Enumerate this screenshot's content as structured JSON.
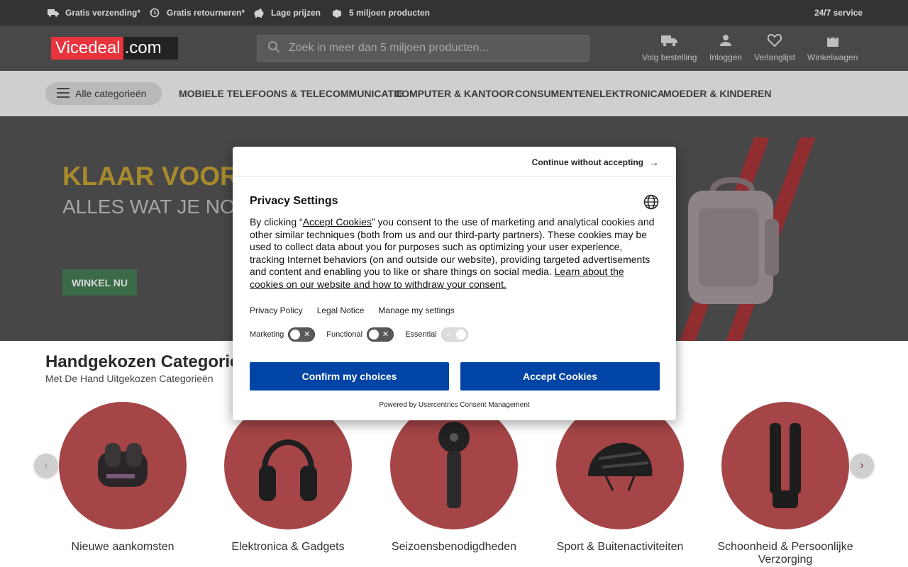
{
  "topbar": {
    "usps": [
      {
        "label": "Gratis verzending*",
        "icon": "truck-icon"
      },
      {
        "label": "Gratis retourneren*",
        "icon": "return-icon"
      },
      {
        "label": "Lage prijzen",
        "icon": "piggybank-icon"
      },
      {
        "label": "5 miljoen producten",
        "icon": "box-icon"
      }
    ],
    "service": "24/7 service"
  },
  "header": {
    "logo_brand": "Vicedeal",
    "logo_tld": ".com",
    "search_placeholder": "Zoek in meer dan 5 miljoen producten...",
    "nav": [
      {
        "label": "Volg bestelling",
        "icon": "truck-icon"
      },
      {
        "label": "Inloggen",
        "icon": "user-icon"
      },
      {
        "label": "Verlanglijst",
        "icon": "heart-icon"
      },
      {
        "label": "Winkelwagen",
        "icon": "bag-icon"
      }
    ]
  },
  "catbar": {
    "all_label": "Alle categorieën",
    "links": [
      "MOBIELE TELEFOONS & TELECOMMUNICATIE",
      "COMPUTER & KANTOOR",
      "CONSUMENTENELEKTRONICA",
      "MOEDER & KINDEREN"
    ]
  },
  "hero": {
    "title": "KLAAR VOOR V",
    "subtitle": "ALLES WAT JE NOD ONDERWEG",
    "button": "WINKEL NU"
  },
  "categories": {
    "title": "Handgekozen Categorieë",
    "subtitle": "Met De Hand Uitgekozen Categorieën",
    "items": [
      "Nieuwe aankomsten",
      "Elektronica & Gadgets",
      "Seizoensbenodigdheden",
      "Sport & Buitenactiviteiten",
      "Schoonheid & Persoonlijke Verzorging"
    ]
  },
  "consent": {
    "continue_label": "Continue without accepting",
    "title": "Privacy Settings",
    "body_pre": "By clicking “",
    "body_link1": "Accept Cookies",
    "body_mid": "” you consent to the use of marketing and analytical cookies and other similar techniques (both from us and our third-party partners). These cookies may be used to collect data about you for purposes such as optimizing your user experience, tracking Internet behaviors (on and outside our website), providing targeted advertisements and content and enabling you to like or share things on social media. ",
    "body_link2": "Learn about the cookies on our website and how to withdraw your consent.",
    "links": [
      "Privacy Policy",
      "Legal Notice",
      "Manage my settings"
    ],
    "toggles": [
      {
        "label": "Marketing",
        "on": false
      },
      {
        "label": "Functional",
        "on": false
      },
      {
        "label": "Essential",
        "on": true
      }
    ],
    "confirm_label": "Confirm my choices",
    "accept_label": "Accept Cookies",
    "powered": "Powered by Usercentrics Consent Management",
    "button_color": "#0045a5"
  }
}
